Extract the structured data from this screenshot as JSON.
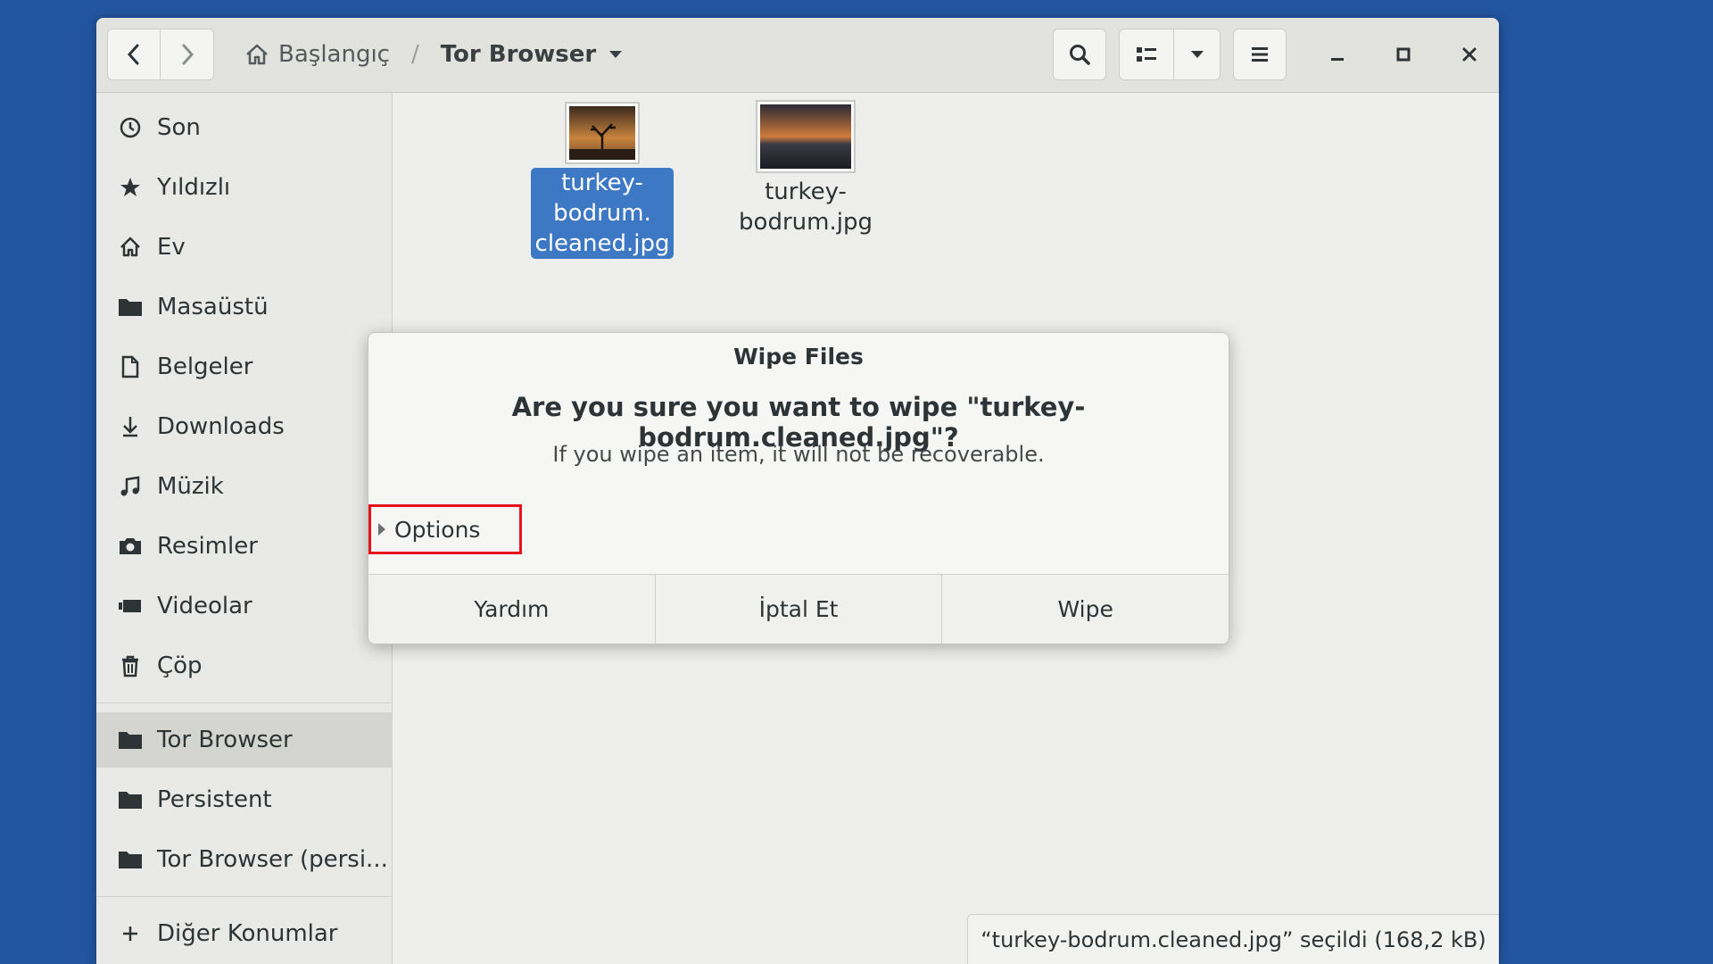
{
  "header": {
    "breadcrumb_home": "Başlangıç",
    "breadcrumb_separator": "/",
    "breadcrumb_current": "Tor Browser"
  },
  "sidebar": {
    "items": [
      {
        "label": "Son",
        "icon": "clock-icon"
      },
      {
        "label": "Yıldızlı",
        "icon": "star-icon"
      },
      {
        "label": "Ev",
        "icon": "home-icon"
      },
      {
        "label": "Masaüstü",
        "icon": "folder-icon"
      },
      {
        "label": "Belgeler",
        "icon": "document-icon"
      },
      {
        "label": "Downloads",
        "icon": "download-icon"
      },
      {
        "label": "Müzik",
        "icon": "music-icon"
      },
      {
        "label": "Resimler",
        "icon": "camera-icon"
      },
      {
        "label": "Videolar",
        "icon": "video-icon"
      },
      {
        "label": "Çöp",
        "icon": "trash-icon"
      }
    ],
    "bookmarks": [
      {
        "label": "Tor Browser",
        "icon": "folder-icon",
        "active": true
      },
      {
        "label": "Persistent",
        "icon": "folder-icon"
      },
      {
        "label": "Tor Browser (persi...",
        "icon": "folder-icon"
      }
    ],
    "other_locations": "Diğer Konumlar"
  },
  "files": [
    {
      "name": "turkey-bodrum.cleaned.jpg",
      "label_lines": [
        "turkey-",
        "bodrum.",
        "cleaned.jpg"
      ],
      "selected": true
    },
    {
      "name": "turkey-bodrum.jpg",
      "label_lines": [
        "turkey-",
        "bodrum.jpg"
      ],
      "selected": false
    }
  ],
  "status": "“turkey-bodrum.cleaned.jpg” seçildi  (168,2 kB)",
  "dialog": {
    "title": "Wipe Files",
    "heading": "Are you sure you want to wipe \"turkey-bodrum.cleaned.jpg\"?",
    "subtext": "If you wipe an item, it will not be recoverable.",
    "options_label": "Options",
    "buttons": {
      "help": "Yardım",
      "cancel": "İptal Et",
      "wipe": "Wipe"
    }
  },
  "colors": {
    "desktop": "#2255a0",
    "selection": "#3d78c4",
    "highlight_box": "#e8121b"
  }
}
